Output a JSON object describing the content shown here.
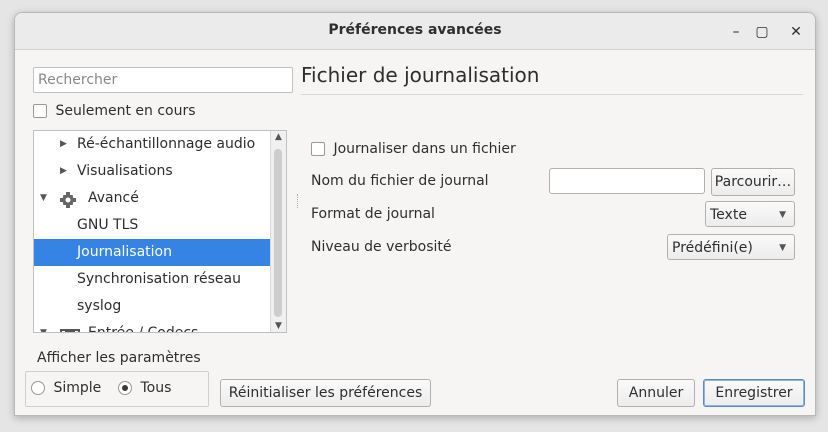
{
  "window": {
    "title": "Préférences avancées",
    "minimize_symbol": "–",
    "maximize_symbol": "▢",
    "close_symbol": "✕"
  },
  "sidebar": {
    "search_placeholder": "Rechercher",
    "only_current_label": "Seulement en cours",
    "tree_items": [
      {
        "label": "Ré-échantillonnage audio",
        "expander": "collapsed"
      },
      {
        "label": "Visualisations",
        "expander": "collapsed"
      },
      {
        "label": "Avancé",
        "expander": "expanded",
        "icon": "gear-icon"
      },
      {
        "label": "GNU TLS"
      },
      {
        "label": "Journalisation",
        "selected": true
      },
      {
        "label": "Synchronisation réseau"
      },
      {
        "label": "syslog"
      },
      {
        "label": "Entrée / Codecs",
        "expander": "expanded",
        "icon": "codec-icon"
      }
    ]
  },
  "main": {
    "title": "Fichier de journalisation",
    "log_to_file_label": "Journaliser dans un fichier",
    "log_filename_label": "Nom du fichier de journal",
    "log_filename_value": "",
    "browse_button": "Parcourir…",
    "log_format_label": "Format de journal",
    "log_format_value": "Texte",
    "verbosity_label": "Niveau de verbosité",
    "verbosity_value": "Prédéfini(e)"
  },
  "footer": {
    "show_settings_label": "Afficher les paramètres",
    "simple_label": "Simple",
    "all_label": "Tous",
    "selected_mode": "Tous",
    "reset_button": "Réinitialiser les préférences",
    "cancel_button": "Annuler",
    "save_button": "Enregistrer"
  },
  "colors": {
    "selection": "#3584e4",
    "window_bg": "#f6f5f4"
  }
}
